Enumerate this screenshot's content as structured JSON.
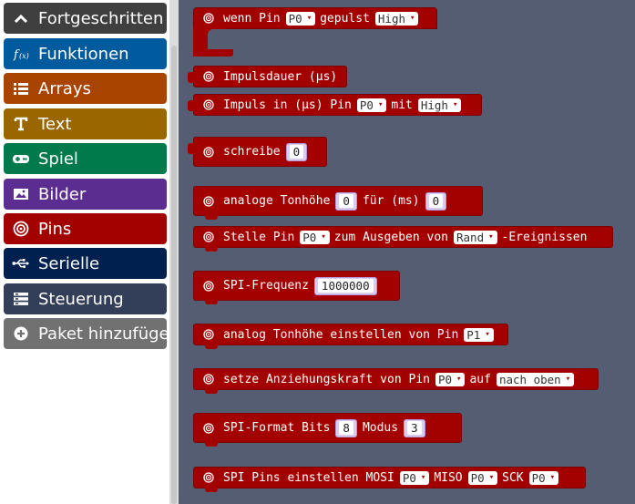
{
  "toolbox": {
    "categories": [
      {
        "label": "Fortgeschritten",
        "color": "#3f3f3f",
        "icon": "chevron-up-icon"
      },
      {
        "label": "Funktionen",
        "color": "#005a9e",
        "icon": "function-icon"
      },
      {
        "label": "Arrays",
        "color": "#a94400",
        "icon": "list-icon"
      },
      {
        "label": "Text",
        "color": "#996600",
        "icon": "text-icon"
      },
      {
        "label": "Spiel",
        "color": "#007a4b",
        "icon": "gamepad-icon"
      },
      {
        "label": "Bilder",
        "color": "#5c2d91",
        "icon": "image-icon"
      },
      {
        "label": "Pins",
        "color": "#a30000",
        "icon": "pin-icon"
      },
      {
        "label": "Serielle",
        "color": "#002050",
        "icon": "usb-icon"
      },
      {
        "label": "Steuerung",
        "color": "#333f58",
        "icon": "control-icon"
      },
      {
        "label": "Paket hinzufügen",
        "color": "#717171",
        "icon": "add-icon"
      }
    ]
  },
  "blocks": {
    "pulsed": {
      "text": "wenn Pin",
      "pin": "P0",
      "text2": "gepulst",
      "value": "High"
    },
    "pulse_duration": {
      "text": "Impulsdauer (µs)"
    },
    "pulse_in": {
      "text": "Impuls in (µs) Pin",
      "pin": "P0",
      "text2": "mit",
      "value": "High"
    },
    "write": {
      "text": "schreibe",
      "value": "0"
    },
    "analog_pitch": {
      "text": "analoge Tonhöhe",
      "value1": "0",
      "text2": "für (ms)",
      "value2": "0"
    },
    "set_events": {
      "text": "Stelle Pin",
      "pin": "P0",
      "text2": "zum Ausgeben von",
      "value": "Rand",
      "text3": "-Ereignissen"
    },
    "spi_frequency": {
      "text": "SPI-Frequenz",
      "value": "1000000"
    },
    "analog_set_pitch_pin": {
      "text": "analog Tonhöhe einstellen von Pin",
      "pin": "P1"
    },
    "set_pull": {
      "text": "setze Anziehungskraft von Pin",
      "pin": "P0",
      "text2": "auf",
      "value": "nach oben"
    },
    "spi_format": {
      "text": "SPI-Format Bits",
      "bits": "8",
      "text2": "Modus",
      "mode": "3"
    },
    "spi_pins": {
      "text": "SPI Pins einstellen MOSI",
      "mosi": "P0",
      "text2": "MISO",
      "miso": "P0",
      "text3": "SCK",
      "sck": "P0"
    }
  },
  "dropdown_arrow": "▾"
}
